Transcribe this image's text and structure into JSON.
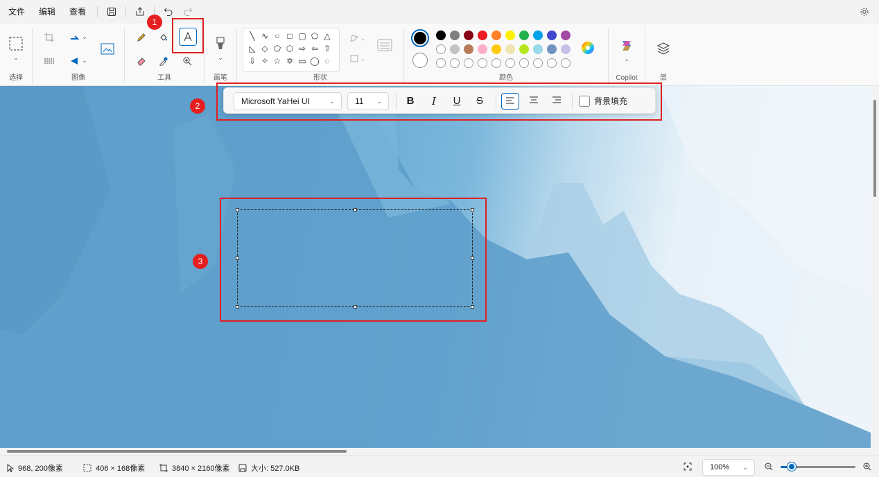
{
  "menu": {
    "file": "文件",
    "edit": "编辑",
    "view": "查看"
  },
  "ribbon": {
    "groups": {
      "select": "选择",
      "image": "图像",
      "tools": "工具",
      "brushes": "画笔",
      "shapes": "形状",
      "colors": "颜色",
      "copilot": "Copilot",
      "layers": "层"
    }
  },
  "shapes": [
    "╲",
    "∿",
    "○",
    "□",
    "▢",
    "⬠",
    "△",
    "◺",
    "◇",
    "⬠",
    "⬡",
    "⇨",
    "⇦",
    "⇧",
    "⇩",
    "✧",
    "☆",
    "✡",
    "▭",
    "◯",
    "◌"
  ],
  "colors": {
    "primary": "#000000",
    "row1": [
      "#000000",
      "#7f7f7f",
      "#880015",
      "#ed1c24",
      "#ff7f27",
      "#fff200",
      "#22b14c",
      "#00a2e8",
      "#3f48cc",
      "#a349a4"
    ],
    "row2": [
      "empty",
      "#c3c3c3",
      "#b97a57",
      "#ffaec9",
      "#ffc90e",
      "#efe4b0",
      "#b5e61d",
      "#99d9ea",
      "#7092be",
      "#c8bfe7"
    ]
  },
  "text_toolbar": {
    "font": "Microsoft YaHei UI",
    "size": "11",
    "bold": "B",
    "italic": "I",
    "underline": "U",
    "strike": "S",
    "fill_label": "背景填充"
  },
  "badges": {
    "b1": "1",
    "b2": "2",
    "b3": "3"
  },
  "status": {
    "cursor": "968, 200像素",
    "selection": "406 × 168像素",
    "canvas_size": "3840 × 2160像素",
    "file_size": "大小: 527.0KB",
    "zoom": "100%",
    "zoom_level": 0.15
  }
}
